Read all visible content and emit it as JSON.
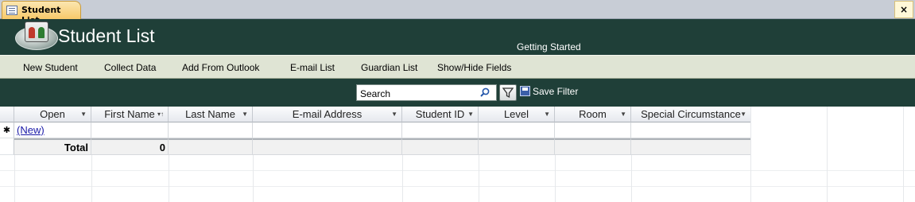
{
  "tab": {
    "label": "Student List",
    "close_glyph": "×"
  },
  "header": {
    "title": "Student List",
    "getting_started": "Getting Started"
  },
  "menu": {
    "new_student": "New Student",
    "collect_data": "Collect Data",
    "add_from_outlook": "Add From Outlook",
    "email_list": "E-mail List",
    "guardian_list": "Guardian List",
    "show_hide_fields": "Show/Hide Fields"
  },
  "search": {
    "placeholder": "Search",
    "value": "Search",
    "save_filter": "Save Filter"
  },
  "columns": {
    "open": "Open",
    "first_name": "First Name",
    "last_name": "Last Name",
    "email": "E-mail Address",
    "student_id": "Student ID",
    "level": "Level",
    "room": "Room",
    "special": "Special Circumstance"
  },
  "rows": {
    "new_marker": "✱",
    "new_link": "(New)",
    "total_label": "Total",
    "total_value": "0"
  }
}
